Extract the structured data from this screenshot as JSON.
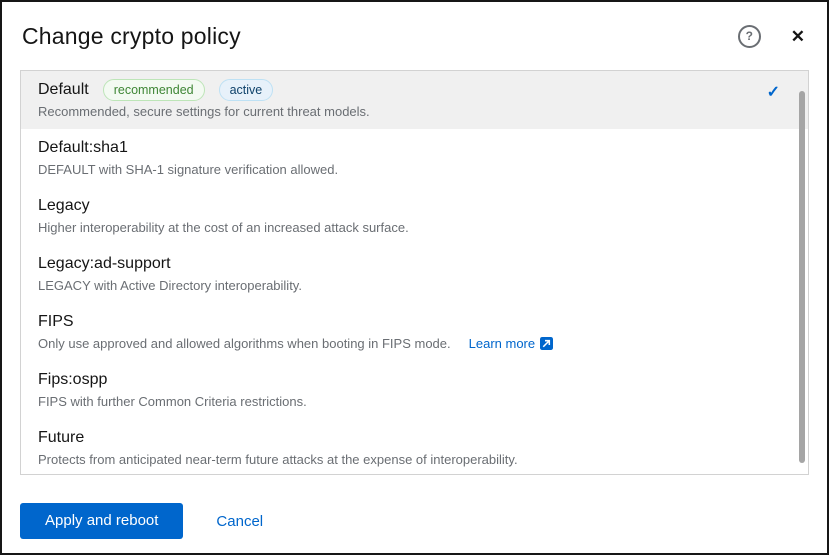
{
  "colors": {
    "accent": "#0066cc",
    "title-color": "#151515",
    "desc-color": "#6a6e73",
    "selected-bg": "#f0f0f0",
    "list-border": "#d2d2d2",
    "badge-green-bg": "#f3faf2",
    "badge-green-border": "#bde5b8",
    "badge-green-text": "#3e8635",
    "badge-blue-bg": "#e7f1fa",
    "badge-blue-border": "#bee1f4",
    "badge-blue-text": "#10436b"
  },
  "icons": {
    "help": "?",
    "close": "✕",
    "check": "✓",
    "external_link": "arrow-up-right-in-square"
  },
  "header": {
    "title": "Change crypto policy"
  },
  "policies": [
    {
      "name": "Default",
      "badges": [
        {
          "label": "recommended",
          "type": "green"
        },
        {
          "label": "active",
          "type": "blue"
        }
      ],
      "description": "Recommended, secure settings for current threat models.",
      "selected": true
    },
    {
      "name": "Default:sha1",
      "description": "DEFAULT with SHA-1 signature verification allowed."
    },
    {
      "name": "Legacy",
      "description": "Higher interoperability at the cost of an increased attack surface."
    },
    {
      "name": "Legacy:ad-support",
      "description": "LEGACY with Active Directory interoperability."
    },
    {
      "name": "FIPS",
      "description": "Only use approved and allowed algorithms when booting in FIPS mode.",
      "link": "Learn more"
    },
    {
      "name": "Fips:ospp",
      "description": "FIPS with further Common Criteria restrictions."
    },
    {
      "name": "Future",
      "description": "Protects from anticipated near-term future attacks at the expense of interoperability."
    }
  ],
  "footer": {
    "apply_label": "Apply and reboot",
    "cancel_label": "Cancel"
  }
}
